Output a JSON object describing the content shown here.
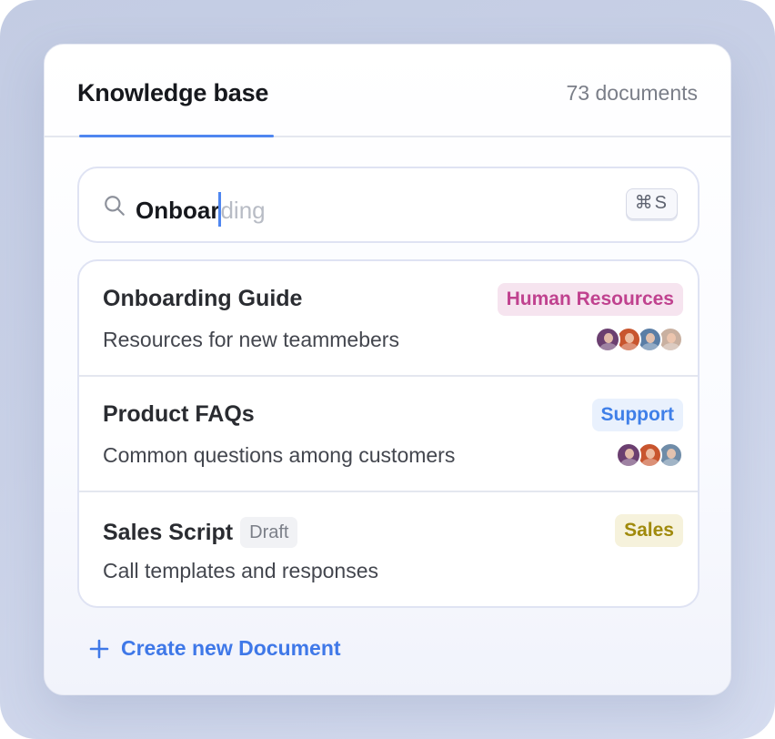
{
  "header": {
    "title": "Knowledge base",
    "doc_count": "73 documents"
  },
  "search": {
    "typed": "Onboar",
    "suggestion": "ding",
    "shortcut": "⌘S"
  },
  "documents": [
    {
      "title": "Onboarding Guide",
      "description": "Resources for new teammebers",
      "tag": "Human Resources",
      "tag_color": "#c0428f",
      "tag_bg": "#f6e4ef",
      "avatar_colors": [
        "#c9b0a0",
        "#5a7ea6",
        "#c8552e",
        "#6b3f70"
      ]
    },
    {
      "title": "Product FAQs",
      "description": "Common questions among customers",
      "tag": "Support",
      "tag_color": "#3f7fe8",
      "tag_bg": "#e9f1fd",
      "avatar_colors": [
        "#6f8ca8",
        "#c8552e",
        "#6b3f70"
      ]
    },
    {
      "title": "Sales Script",
      "badge": "Draft",
      "description": "Call templates and responses",
      "tag": "Sales",
      "tag_color": "#a08a0c",
      "tag_bg": "#f6f2dc",
      "avatar_colors": []
    }
  ],
  "create_label": "Create new Document",
  "colors": {
    "accent": "#4f86f0",
    "link": "#3f78e8"
  }
}
